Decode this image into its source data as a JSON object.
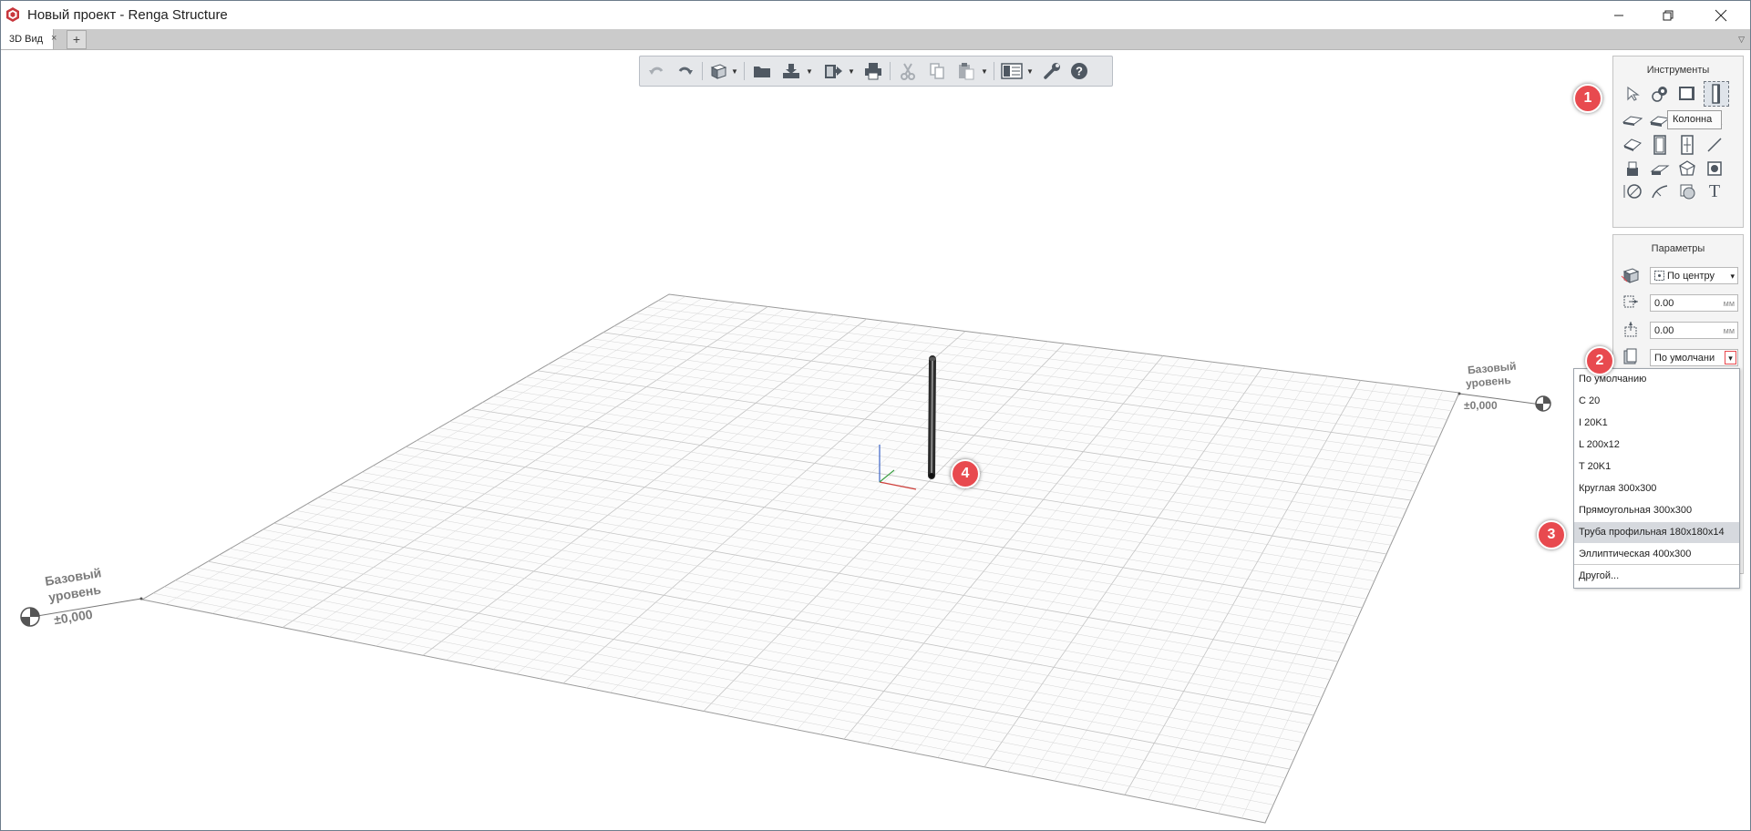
{
  "window": {
    "title": "Новый проект - Renga Structure",
    "minimize_glyph": "—",
    "restore_glyph": "❐",
    "close_glyph": "✕"
  },
  "tabs": {
    "items": [
      {
        "label": "3D Вид",
        "close": "×"
      }
    ],
    "add_label": "+",
    "menu_glyph": "▽"
  },
  "toolbar": {
    "icons": [
      "undo-icon",
      "redo-icon",
      "view-cube-icon",
      "open-folder-icon",
      "import-icon",
      "export-icon",
      "print-icon",
      "cut-icon",
      "copy-icon",
      "paste-icon",
      "display-mode-icon",
      "settings-wrench-icon",
      "help-icon"
    ],
    "dropdown_glyph": "▼",
    "help_label": "?"
  },
  "tools_panel": {
    "title": "Инструменты",
    "tooltip": "Колонна",
    "text_tool_label": "T"
  },
  "params_panel": {
    "title": "Параметры",
    "alignment": {
      "value": "По центру",
      "arrow": "▾"
    },
    "offset_x": {
      "value": "0.00",
      "unit": "мм"
    },
    "offset_z": {
      "value": "0.00",
      "unit": "мм"
    },
    "section": {
      "value": "По умолчани",
      "arrow": "▾"
    }
  },
  "section_dropdown": {
    "options": [
      "По умолчанию",
      "C 20",
      "I 20K1",
      "L 200x12",
      "T 20K1",
      "Круглая 300x300",
      "Прямоугольная 300x300",
      "Труба профильная 180x180x14",
      "Эллиптическая 400x300",
      "Другой..."
    ],
    "highlighted": "Труба профильная 180x180x14"
  },
  "levels": {
    "left": {
      "line1": "Базовый",
      "line2": "уровень",
      "elev": "±0,000"
    },
    "right": {
      "line1": "Базовый",
      "line2": "уровень",
      "elev": "±0,000"
    }
  },
  "callouts": {
    "c1": "1",
    "c2": "2",
    "c3": "3",
    "c4": "4"
  },
  "colors": {
    "accent": "#e84a4f",
    "grid": "#d5d5d5",
    "panel": "#f4f4f4",
    "highlight": "#d6d9de"
  }
}
